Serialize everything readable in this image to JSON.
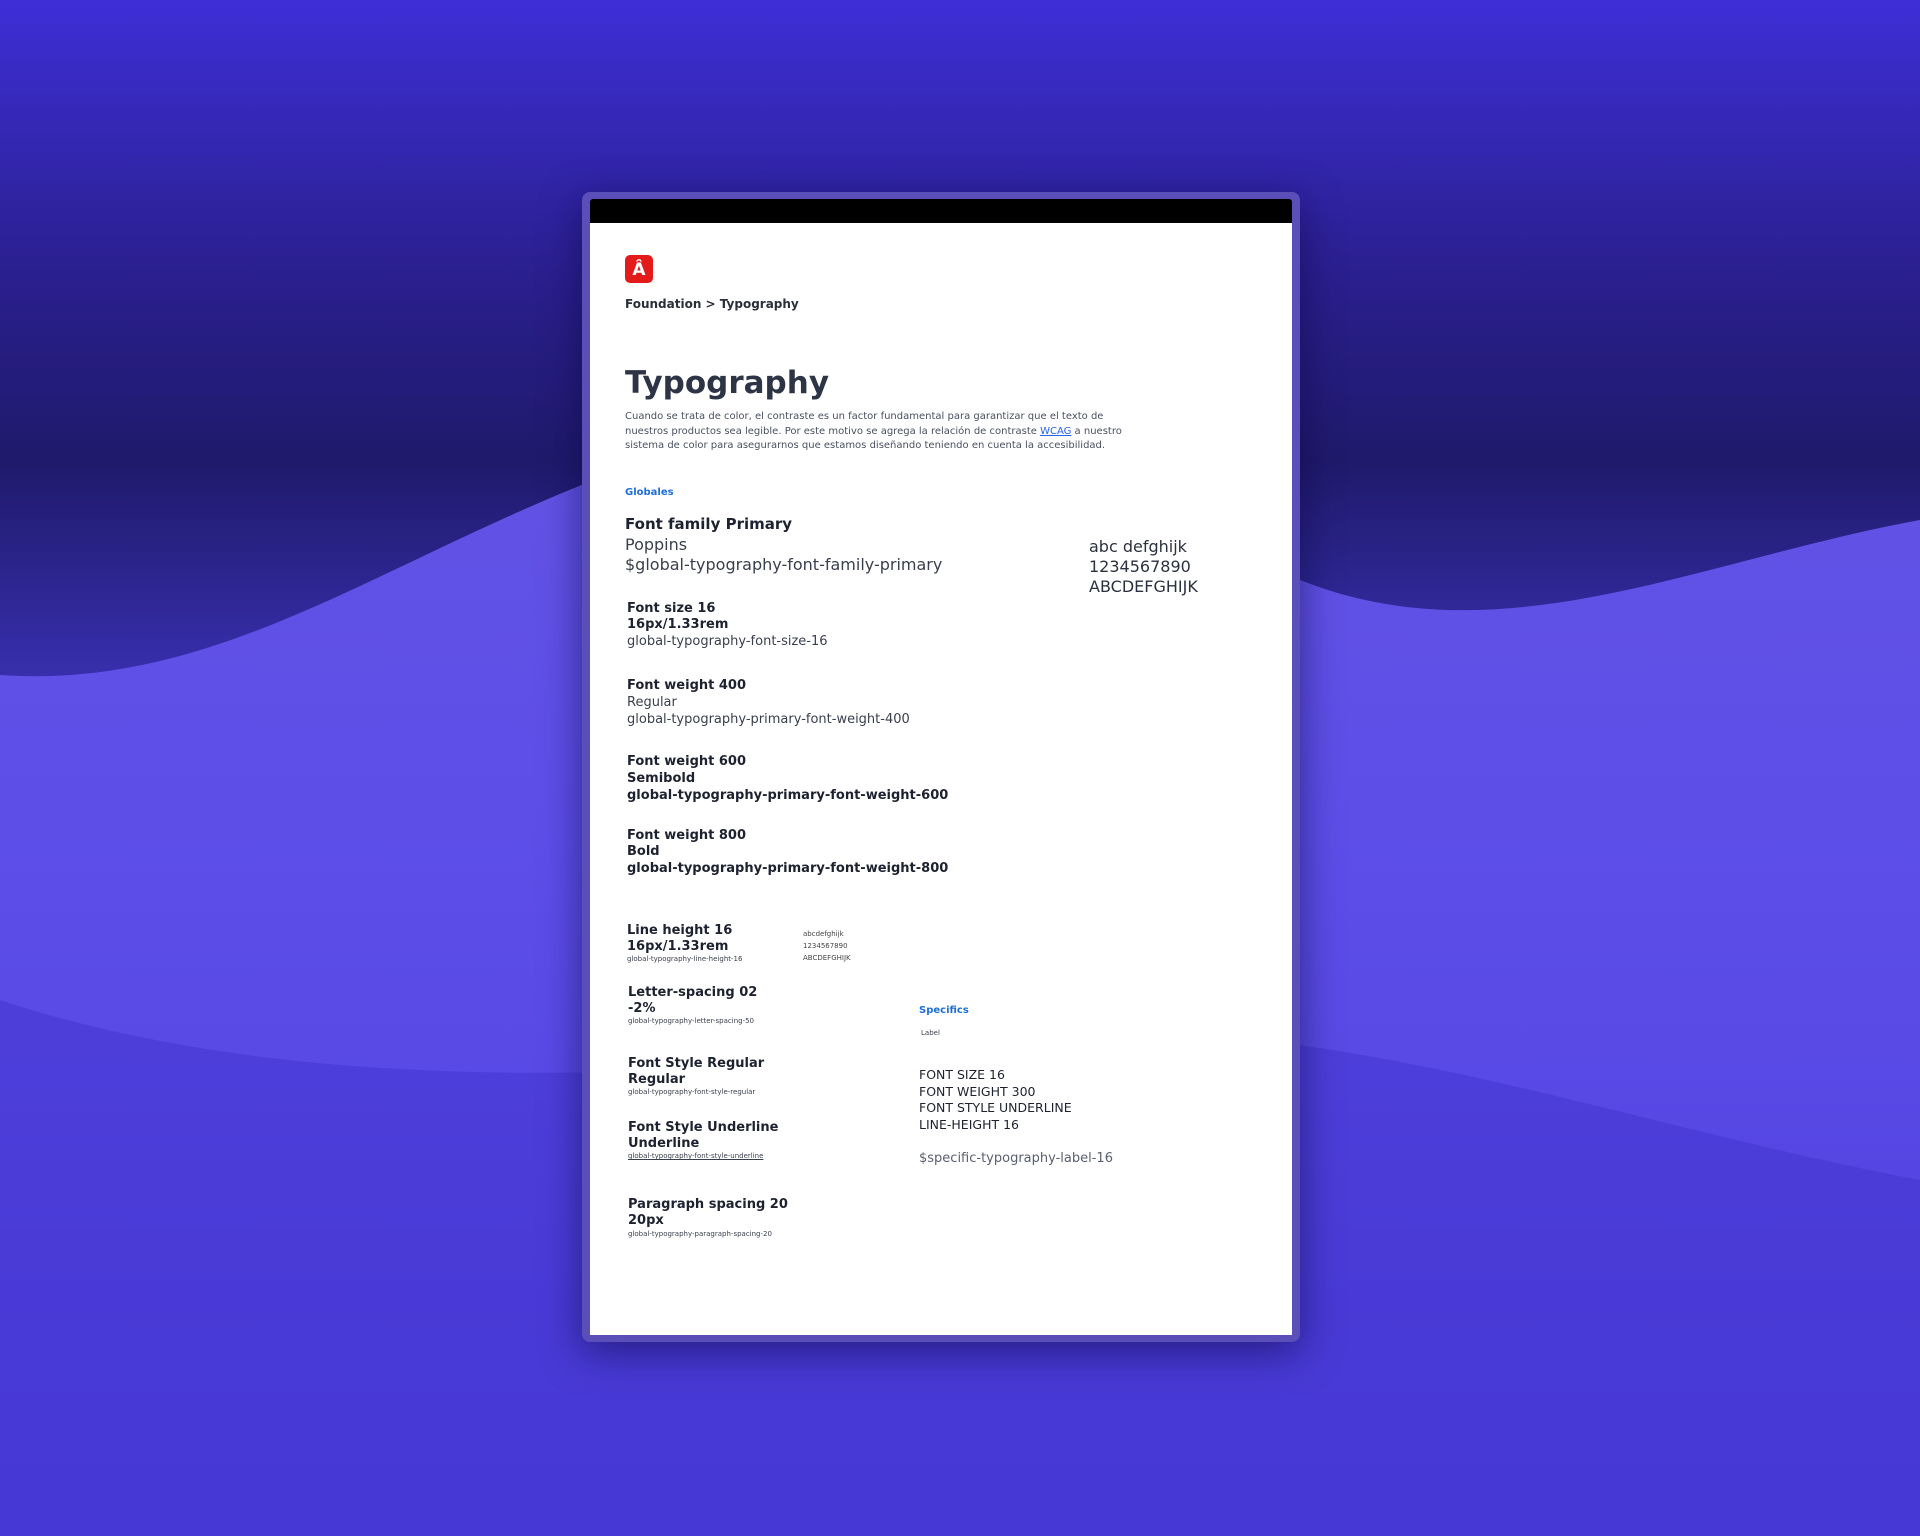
{
  "breadcrumb": "Foundation > Typography",
  "page_title": "Typography",
  "intro": {
    "before_link": "Cuando se trata de color, el contraste es un factor fundamental para garantizar que el texto de nuestros productos sea legible. Por este motivo se agrega la relación de contraste ",
    "link": "WCAG",
    "after_link": "  a nuestro sistema de color para asegurarnos que estamos diseñando teniendo en cuenta la accesibilidad."
  },
  "globales": {
    "section_label": "Globales",
    "font_family": {
      "title": "Font family Primary",
      "name": "Poppins",
      "token": "$global-typography-font-family-primary",
      "sample": [
        "abc defghijk",
        "1234567890",
        "ABCDEFGHIJK"
      ]
    },
    "font_size": {
      "title": "Font size 16",
      "value": "16px/1.33rem",
      "token": "global-typography-font-size-16"
    },
    "weight_400": {
      "title": "Font weight 400",
      "value": "Regular",
      "token": "global-typography-primary-font-weight-400"
    },
    "weight_600": {
      "title": "Font weight 600",
      "value": "Semibold",
      "token": "global-typography-primary-font-weight-600"
    },
    "weight_800": {
      "title": "Font weight 800",
      "value": "Bold",
      "token": "global-typography-primary-font-weight-800"
    },
    "line_height": {
      "title": "Line height 16",
      "value": "16px/1.33rem",
      "token": "global-typography-line-height-16",
      "sample": [
        "abcdefghijk",
        "1234567890",
        "ABCDEFGHIJK"
      ]
    },
    "letter_spacing": {
      "title": "Letter-spacing 02",
      "value": "-2%",
      "token": "global-typography-letter-spacing-50"
    },
    "style_regular": {
      "title": "Font Style Regular",
      "value": "Regular",
      "token": "global-typography-font-style-regular"
    },
    "style_underline": {
      "title": "Font Style Underline",
      "value": "Underline",
      "token": "global-typography-font-style-underline"
    },
    "paragraph_spacing": {
      "title": "Paragraph  spacing 20",
      "value": "20px",
      "token": "global-typography-paragraph-spacing-20"
    }
  },
  "specifics": {
    "section_label": "Specifics",
    "label": "Label",
    "props": [
      "FONT SIZE 16",
      "FONT WEIGHT 300",
      "FONT STYLE UNDERLINE",
      "LINE-HEIGHT 16"
    ],
    "token": "$specific-typography-label-16"
  },
  "colors": {
    "brand_red": "#e41b1b",
    "section_blue": "#1d6fd6",
    "background_purple": "#4a3fe0"
  }
}
